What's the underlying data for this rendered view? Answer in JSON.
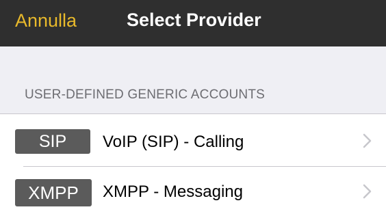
{
  "navbar": {
    "cancel_label": "Annulla",
    "title": "Select Provider"
  },
  "section": {
    "header": "USER-DEFINED GENERIC ACCOUNTS"
  },
  "providers": [
    {
      "badge": "SIP",
      "label": "VoIP (SIP) - Calling"
    },
    {
      "badge": "XMPP",
      "label": "XMPP - Messaging"
    }
  ],
  "colors": {
    "navbar_bg": "#2f2f2f",
    "accent": "#e8b92b",
    "badge_bg": "#5b5b5b",
    "page_bg": "#efeff4"
  },
  "icons": {
    "row_disclosure": "chevron-right-icon"
  }
}
